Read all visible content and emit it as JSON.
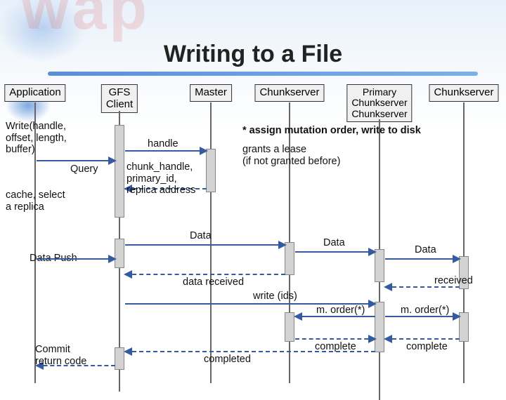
{
  "title": "Writing to a File",
  "watermark": "wap",
  "lifelines": {
    "app": "Application",
    "client": "GFS\nClient",
    "master": "Master",
    "cs1": "Chunkserver",
    "primary": "Primary\nChunkserver\nChunkserver",
    "cs2": "Chunkserver"
  },
  "messages": {
    "write_call": "Write(handle,\noffset, length,\nbuffer)",
    "query": "Query",
    "handle": "handle",
    "chunk_reply": "chunk_handle,\nprimary_id,\nreplica address",
    "cache_select": "cache, select\na replica",
    "data_push": "Data Push",
    "data1": "Data",
    "data2": "Data",
    "data3": "Data",
    "data_received": "data received",
    "received": "received",
    "write_ids": "write (ids)",
    "m_order1": "m. order(*)",
    "m_order2": "m. order(*)",
    "complete1": "complete",
    "complete2": "complete",
    "completed": "completed",
    "commit": "Commit\nreturn code"
  },
  "note_assign": "* assign mutation order, write to disk",
  "note_lease": "grants a lease\n(if not granted before)"
}
